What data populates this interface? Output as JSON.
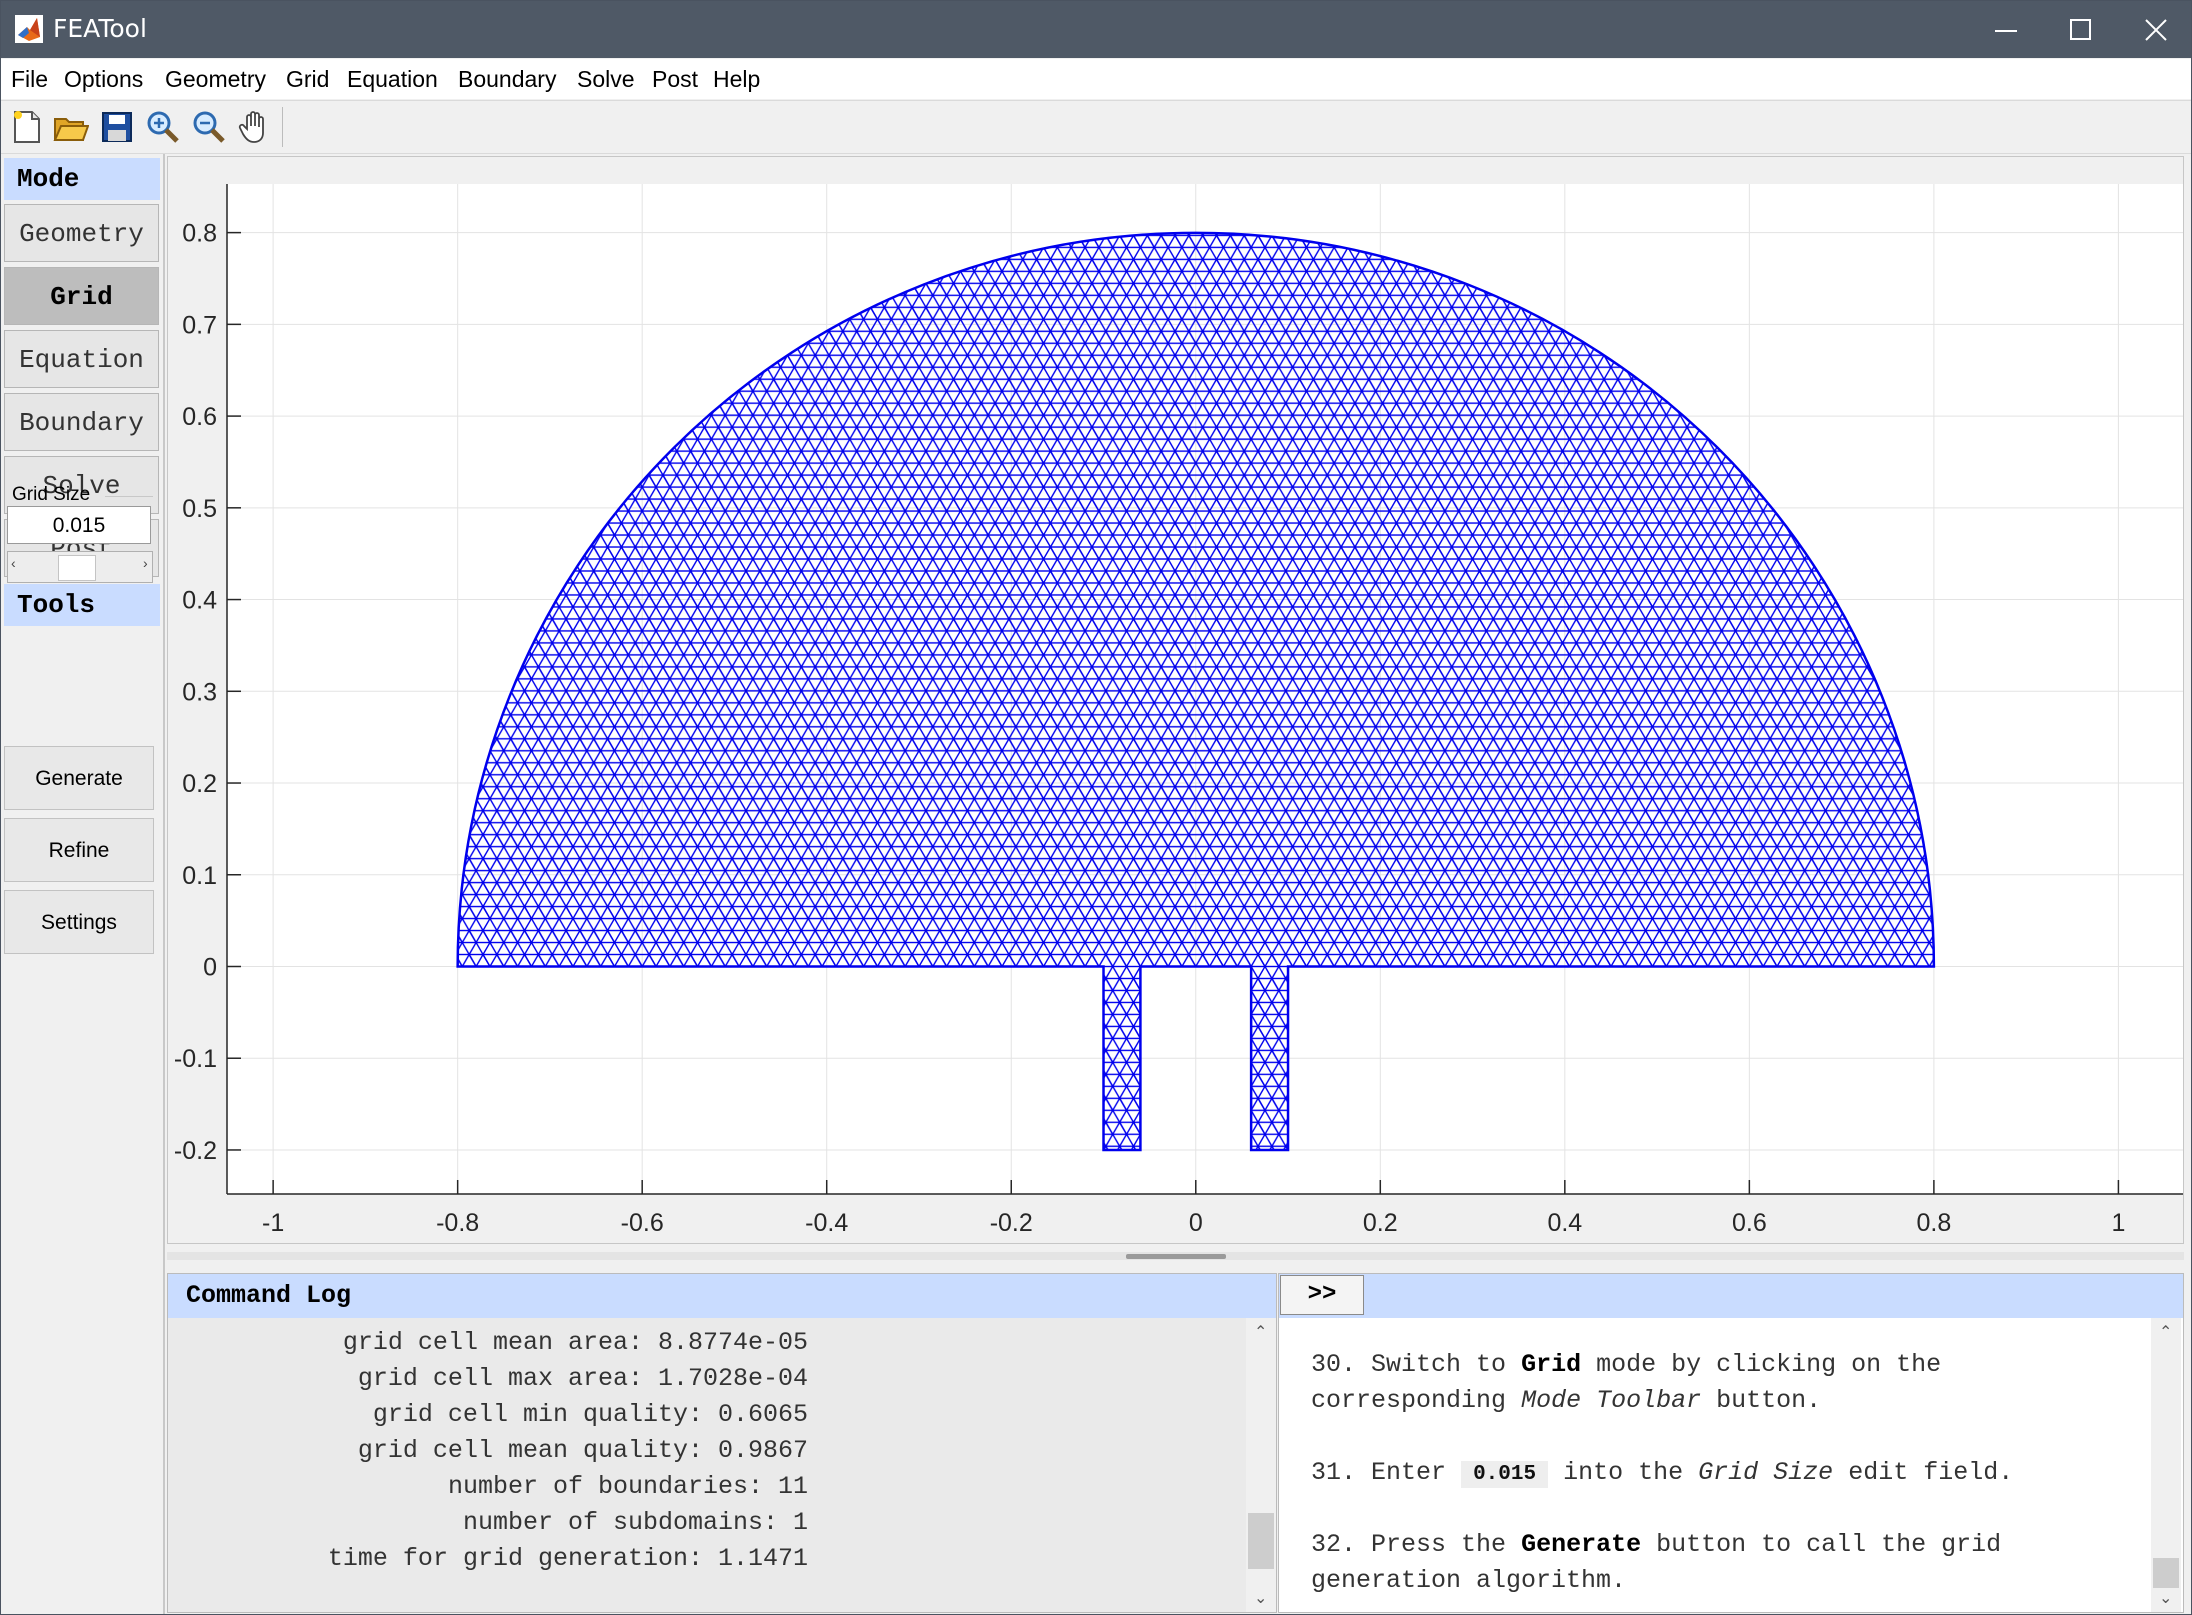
{
  "window": {
    "title": "FEATool"
  },
  "menu": [
    "File",
    "Options",
    "Geometry",
    "Grid",
    "Equation",
    "Boundary",
    "Solve",
    "Post",
    "Help"
  ],
  "toolbar": [
    "new-file-icon",
    "open-folder-icon",
    "save-icon",
    "zoom-in-icon",
    "zoom-out-icon",
    "pan-hand-icon"
  ],
  "sidebar": {
    "mode_header": "Mode",
    "modes": [
      "Geometry",
      "Grid",
      "Equation",
      "Boundary",
      "Solve",
      "Post"
    ],
    "active_mode": "Grid",
    "tools_header": "Tools",
    "grid_size_label": "Grid Size",
    "grid_size_value": "0.015",
    "buttons": [
      "Generate",
      "Refine",
      "Settings"
    ]
  },
  "plot": {
    "xticks": [
      "-1",
      "-0.8",
      "-0.6",
      "-0.4",
      "-0.2",
      "0",
      "0.2",
      "0.4",
      "0.6",
      "0.8",
      "1"
    ],
    "yticks": [
      "0.8",
      "0.7",
      "0.6",
      "0.5",
      "0.4",
      "0.3",
      "0.2",
      "0.1",
      "0",
      "-0.1",
      "-0.2"
    ],
    "mesh_color": "#0000ee"
  },
  "chart_data": {
    "type": "mesh",
    "xlim": [
      -1.05,
      1.07
    ],
    "ylim": [
      -0.248,
      0.853
    ],
    "xtick_values": [
      -1,
      -0.8,
      -0.6,
      -0.4,
      -0.2,
      0,
      0.2,
      0.4,
      0.6,
      0.8,
      1
    ],
    "ytick_values": [
      0.8,
      0.7,
      0.6,
      0.5,
      0.4,
      0.3,
      0.2,
      0.1,
      0,
      -0.1,
      -0.2
    ],
    "grid": true,
    "half_disk": {
      "radius": 0.8,
      "center": [
        0,
        0
      ]
    },
    "inlets": [
      {
        "x": [
          -0.1,
          -0.06
        ],
        "y": [
          -0.2,
          0
        ]
      },
      {
        "x": [
          0.06,
          0.1
        ],
        "y": [
          -0.2,
          0
        ]
      }
    ],
    "grid_size": 0.015
  },
  "log": {
    "header": "Command Log",
    "lines": [
      "grid cell mean area: 8.8774e-05",
      "grid cell max area: 1.7028e-04",
      "grid cell min quality: 0.6065",
      "grid cell mean quality: 0.9867",
      "number of boundaries: 11",
      "number of subdomains: 1",
      "time for grid generation: 1.1471"
    ]
  },
  "help": {
    "toggle": ">>",
    "s30": {
      "num": "30.",
      "t1": "Switch to",
      "b1": "Grid",
      "t2": "mode by clicking on the",
      "t3": "corresponding",
      "i1": "Mode Toolbar",
      "t4": "button."
    },
    "s31": {
      "num": "31.",
      "t1": "Enter",
      "k1": "0.015",
      "t2": "into the",
      "i1": "Grid Size",
      "t3": "edit field."
    },
    "s32": {
      "num": "32.",
      "t1": "Press the",
      "b1": "Generate",
      "t2": "button to call the grid",
      "t3": "generation algorithm."
    }
  }
}
